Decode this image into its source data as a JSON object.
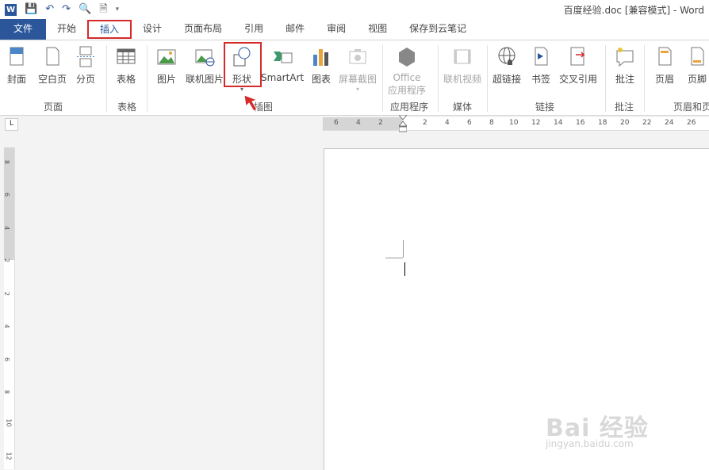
{
  "window": {
    "title": "百度经验.doc [兼容模式] - Word"
  },
  "quick_access": {
    "icons": [
      "word-logo-icon",
      "save-icon",
      "undo-icon",
      "redo-icon",
      "print-preview-icon",
      "new-document-icon",
      "customize-icon"
    ]
  },
  "tabs": [
    "文件",
    "开始",
    "插入",
    "设计",
    "页面布局",
    "引用",
    "邮件",
    "审阅",
    "视图",
    "保存到云笔记"
  ],
  "ribbon": {
    "buttons": {
      "cover": "封面",
      "blank": "空白页",
      "break": "分页",
      "table": "表格",
      "picture": "图片",
      "online_picture": "联机图片",
      "shapes": "形状",
      "smartart": "SmartArt",
      "chart": "图表",
      "screenshot": "屏幕截图",
      "office_apps_1": "Office",
      "office_apps_2": "应用程序",
      "online_video": "联机视频",
      "hyperlink": "超链接",
      "bookmark": "书签",
      "cross_ref": "交叉引用",
      "comment": "批注",
      "header": "页眉",
      "footer": "页脚"
    },
    "groups": {
      "pages": "页面",
      "tables": "表格",
      "illustrations": "插图",
      "apps": "应用程序",
      "media": "媒体",
      "links": "链接",
      "comments": "批注",
      "header_footer": "页眉和页"
    }
  },
  "ruler": {
    "h_ticks": [
      "6",
      "4",
      "2",
      "2",
      "4",
      "6",
      "8",
      "10",
      "12",
      "14",
      "16",
      "18",
      "20",
      "22",
      "24",
      "26"
    ],
    "v_ticks": [
      "8",
      "6",
      "4",
      "2",
      "2",
      "4",
      "6",
      "8",
      "10",
      "12"
    ],
    "tab_selector": "L"
  },
  "watermark": {
    "brand": "Bai 经验",
    "url": "jingyan.baidu.com"
  },
  "colors": {
    "accent": "#2b579a",
    "highlight": "#d42a2a"
  }
}
